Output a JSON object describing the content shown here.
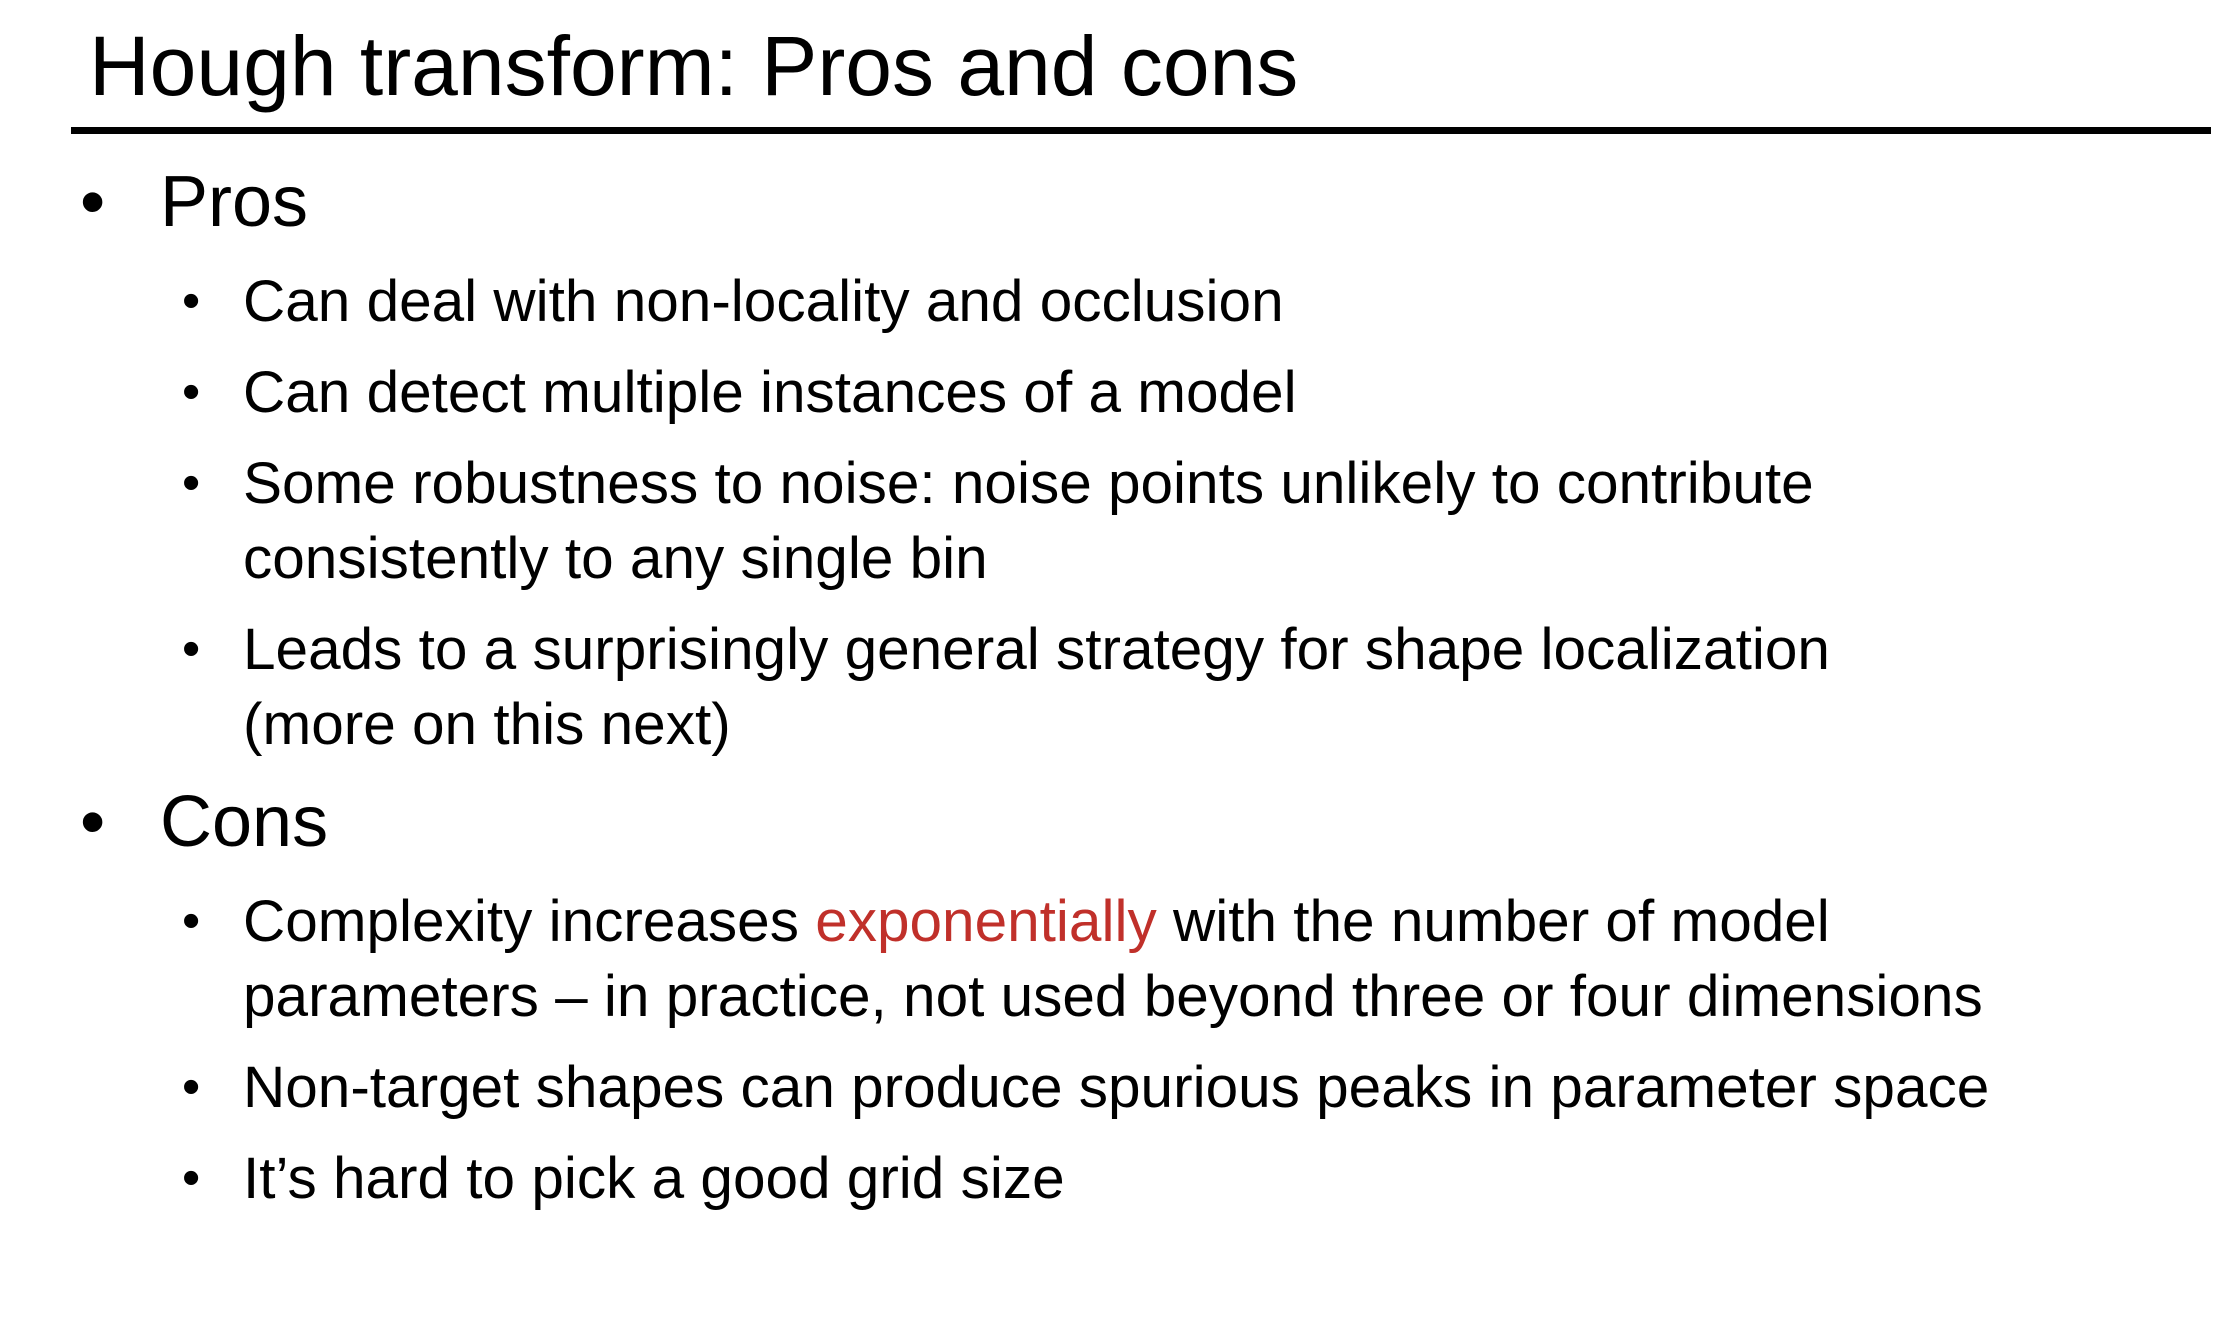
{
  "slide": {
    "title": "Hough transform: Pros and cons",
    "bullet_glyph": "•",
    "colors": {
      "text": "#000000",
      "rule": "#000000",
      "emphasis": "#c0302a",
      "background": "#ffffff"
    },
    "sections": [
      {
        "heading": "Pros",
        "items": [
          {
            "lines": [
              "Can deal with non-locality and occlusion"
            ]
          },
          {
            "lines": [
              "Can detect multiple instances of a model"
            ]
          },
          {
            "lines": [
              "Some robustness to noise: noise points unlikely to contribute",
              "consistently to any single bin"
            ]
          },
          {
            "lines": [
              "Leads to a surprisingly general strategy for shape localization",
              "(more on this next)"
            ]
          }
        ]
      },
      {
        "heading": "Cons",
        "items": [
          {
            "line1": {
              "before": "Complexity increases ",
              "emphasis": "exponentially",
              "after": " with the number of model"
            },
            "line2": "parameters – in practice, not used beyond three or four dimensions"
          },
          {
            "lines": [
              "Non-target shapes can produce spurious peaks in parameter space"
            ]
          },
          {
            "lines": [
              "It’s hard to pick a good grid size"
            ]
          }
        ]
      }
    ]
  }
}
